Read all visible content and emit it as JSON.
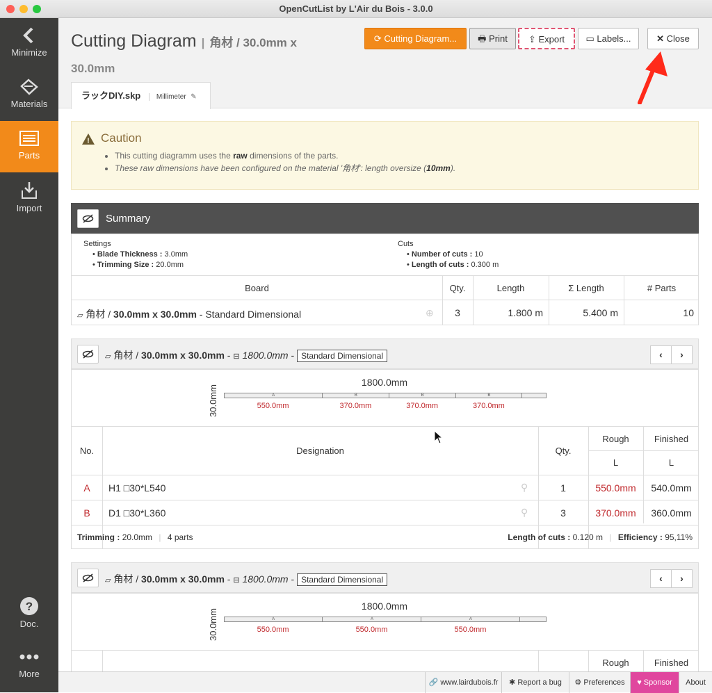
{
  "window_title": "OpenCutList by L'Air du Bois - 3.0.0",
  "sidebar": {
    "minimize": "Minimize",
    "materials": "Materials",
    "parts": "Parts",
    "import": "Import",
    "doc": "Doc.",
    "more": "More"
  },
  "header": {
    "title": "Cutting Diagram",
    "title_sub_1": "角材 / 30.0mm x",
    "title_sub_2": "30.0mm",
    "buttons": {
      "cutting_diagram": "Cutting Diagram...",
      "print": "Print",
      "export": "Export",
      "labels": "Labels...",
      "close": "Close"
    },
    "tab": {
      "file": "ラックDIY.skp",
      "unit": "Millimeter"
    }
  },
  "caution": {
    "title": "Caution",
    "line1_pre": "This cutting diagramm uses the ",
    "line1_bold": "raw",
    "line1_post": " dimensions of the parts.",
    "line2_pre": "These raw dimensions have been configured on the material '角材': length oversize (",
    "line2_bold": "10mm",
    "line2_post": ")."
  },
  "summary": {
    "title": "Summary",
    "settings_label": "Settings",
    "blade_label": "Blade Thickness :",
    "blade_value": "3.0mm",
    "trim_label": "Trimming Size :",
    "trim_value": "20.0mm",
    "cuts_label": "Cuts",
    "num_cuts_label": "Number of cuts :",
    "num_cuts_value": "10",
    "len_cuts_label": "Length of cuts :",
    "len_cuts_value": "0.300 m",
    "table": {
      "headers": [
        "Board",
        "Qty.",
        "Length",
        "Σ Length",
        "# Parts"
      ],
      "row": {
        "board_pre": "角材 / ",
        "board_bold": "30.0mm x 30.0mm",
        "board_post": " - Standard Dimensional",
        "qty": "3",
        "length": "1.800 m",
        "sum_length": "5.400 m",
        "parts": "10"
      }
    }
  },
  "board1": {
    "material": "角材 / ",
    "dims": "30.0mm x 30.0mm",
    "sep": " - ",
    "length": "1800.0mm",
    "sep2": " - ",
    "type": "Standard Dimensional",
    "diagram": {
      "length_label": "1800.0mm",
      "width_label": "30.0mm",
      "segments": [
        {
          "letter": "A",
          "label": "550.0mm",
          "length": 550
        },
        {
          "letter": "B",
          "label": "370.0mm",
          "length": 370
        },
        {
          "letter": "B",
          "label": "370.0mm",
          "length": 370
        },
        {
          "letter": "B",
          "label": "370.0mm",
          "length": 370
        }
      ]
    },
    "table": {
      "h_no": "No.",
      "h_designation": "Designation",
      "h_qty": "Qty.",
      "h_rough": "Rough",
      "h_finished": "Finished",
      "h_l": "L",
      "rows": [
        {
          "no": "A",
          "designation": "H1 □30*L540",
          "qty": "1",
          "rough": "550.0mm",
          "finished": "540.0mm"
        },
        {
          "no": "B",
          "designation": "D1 □30*L360",
          "qty": "3",
          "rough": "370.0mm",
          "finished": "360.0mm"
        }
      ]
    },
    "footer": {
      "trim_label": "Trimming :",
      "trim_value": "20.0mm",
      "parts": "4 parts",
      "len_label": "Length of cuts :",
      "len_value": "0.120 m",
      "eff_label": "Efficiency :",
      "eff_value": "95,11%"
    }
  },
  "board2": {
    "material": "角材 / ",
    "dims": "30.0mm x 30.0mm",
    "sep": " - ",
    "length": "1800.0mm",
    "sep2": " - ",
    "type": "Standard Dimensional",
    "diagram": {
      "length_label": "1800.0mm",
      "width_label": "30.0mm",
      "segments": [
        {
          "letter": "A",
          "label": "550.0mm",
          "length": 550
        },
        {
          "letter": "A",
          "label": "550.0mm",
          "length": 550
        },
        {
          "letter": "A",
          "label": "550.0mm",
          "length": 550
        }
      ]
    },
    "table": {
      "h_rough": "Rough",
      "h_finished": "Finished"
    }
  },
  "footer": {
    "website": "www.lairdubois.fr",
    "bug": "Report a bug",
    "preferences": "Preferences",
    "sponsor": "Sponsor",
    "about": "About"
  },
  "colors": {
    "accent": "#f28a1a",
    "sidebar": "#3d3d3b",
    "sponsor": "#e0479e",
    "annotation_arrow": "#ff2a1a"
  }
}
